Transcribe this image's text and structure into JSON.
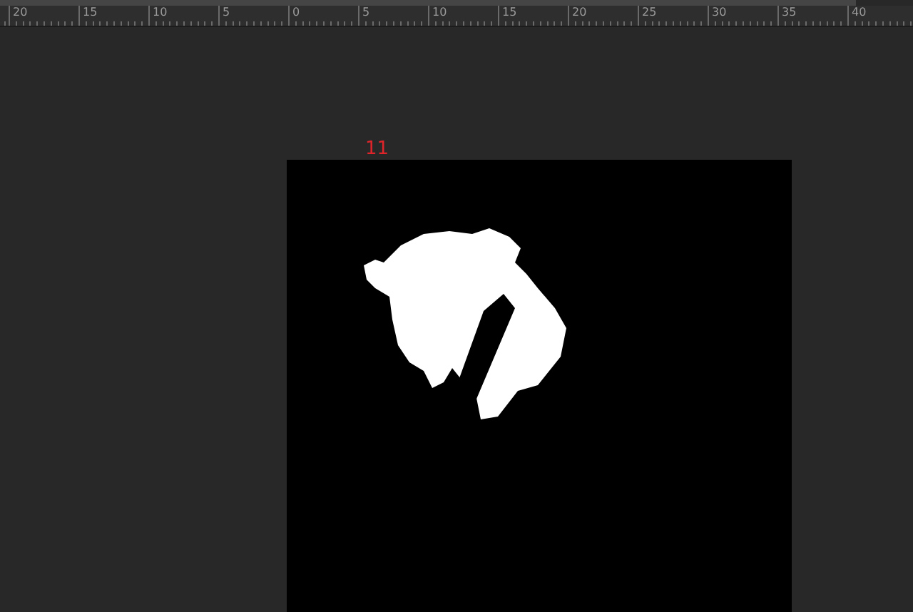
{
  "ruler": {
    "labels": [
      "20",
      "15",
      "10",
      "5",
      "0",
      "5",
      "10",
      "15",
      "20",
      "25",
      "30",
      "35",
      "40"
    ]
  },
  "canvas": {
    "label": "11"
  }
}
